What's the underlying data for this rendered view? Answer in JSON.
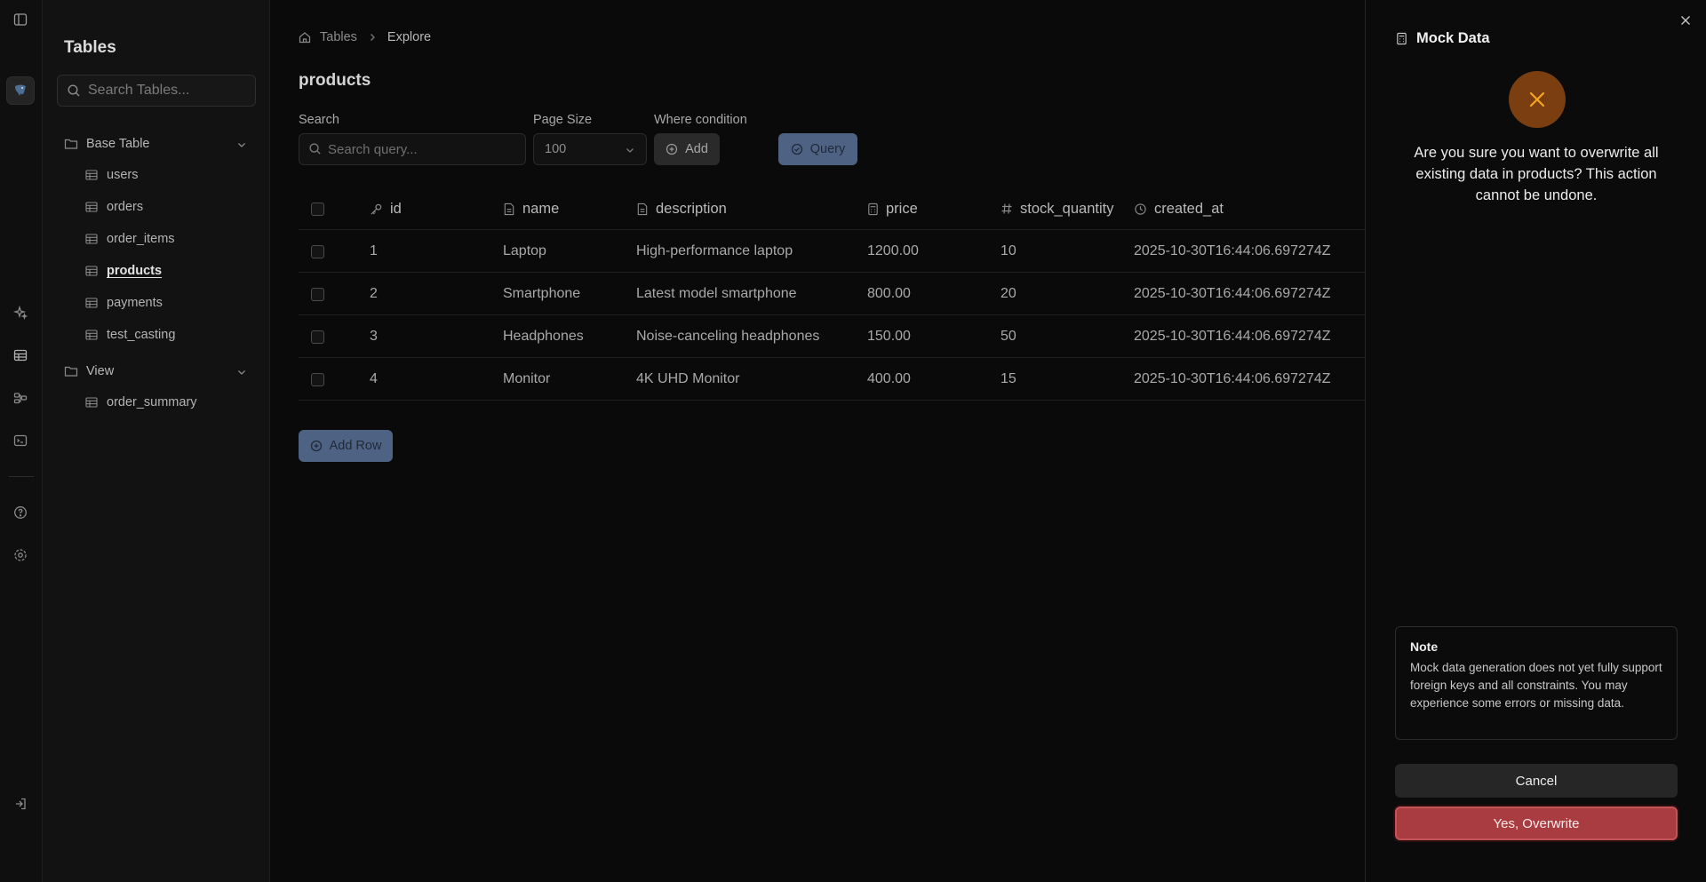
{
  "sidebar": {
    "title": "Tables",
    "search_placeholder": "Search Tables...",
    "groups": [
      {
        "label": "Base Table",
        "items": [
          "users",
          "orders",
          "order_items",
          "products",
          "payments",
          "test_casting"
        ]
      },
      {
        "label": "View",
        "items": [
          "order_summary"
        ]
      }
    ],
    "active_item": "products"
  },
  "breadcrumb": {
    "root": "Tables",
    "current": "Explore"
  },
  "page": {
    "title": "products"
  },
  "filters": {
    "search_label": "Search",
    "search_placeholder": "Search query...",
    "page_size_label": "Page Size",
    "page_size_value": "100",
    "where_label": "Where condition",
    "add_label": "Add",
    "query_label": "Query"
  },
  "table": {
    "columns": [
      {
        "name": "id",
        "icon": "key-icon"
      },
      {
        "name": "name",
        "icon": "text-file-icon"
      },
      {
        "name": "description",
        "icon": "text-file-icon"
      },
      {
        "name": "price",
        "icon": "calculator-icon"
      },
      {
        "name": "stock_quantity",
        "icon": "hash-icon"
      },
      {
        "name": "created_at",
        "icon": "clock-icon"
      }
    ],
    "rows": [
      [
        "1",
        "Laptop",
        "High-performance laptop",
        "1200.00",
        "10",
        "2025-10-30T16:44:06.697274Z"
      ],
      [
        "2",
        "Smartphone",
        "Latest model smartphone",
        "800.00",
        "20",
        "2025-10-30T16:44:06.697274Z"
      ],
      [
        "3",
        "Headphones",
        "Noise-canceling headphones",
        "150.00",
        "50",
        "2025-10-30T16:44:06.697274Z"
      ],
      [
        "4",
        "Monitor",
        "4K UHD Monitor",
        "400.00",
        "15",
        "2025-10-30T16:44:06.697274Z"
      ]
    ]
  },
  "add_row_label": "Add Row",
  "panel": {
    "title": "Mock Data",
    "message": "Are you sure you want to overwrite all existing data in products? This action cannot be undone.",
    "note_title": "Note",
    "note_body": "Mock data generation does not yet fully support foreign keys and all constraints. You may experience some errors or missing data.",
    "cancel_label": "Cancel",
    "confirm_label": "Yes, Overwrite"
  },
  "colors": {
    "accent": "#4e6384",
    "danger": "#a83c40",
    "warning": "#7a3e10",
    "warning_icon": "#f5a524"
  }
}
